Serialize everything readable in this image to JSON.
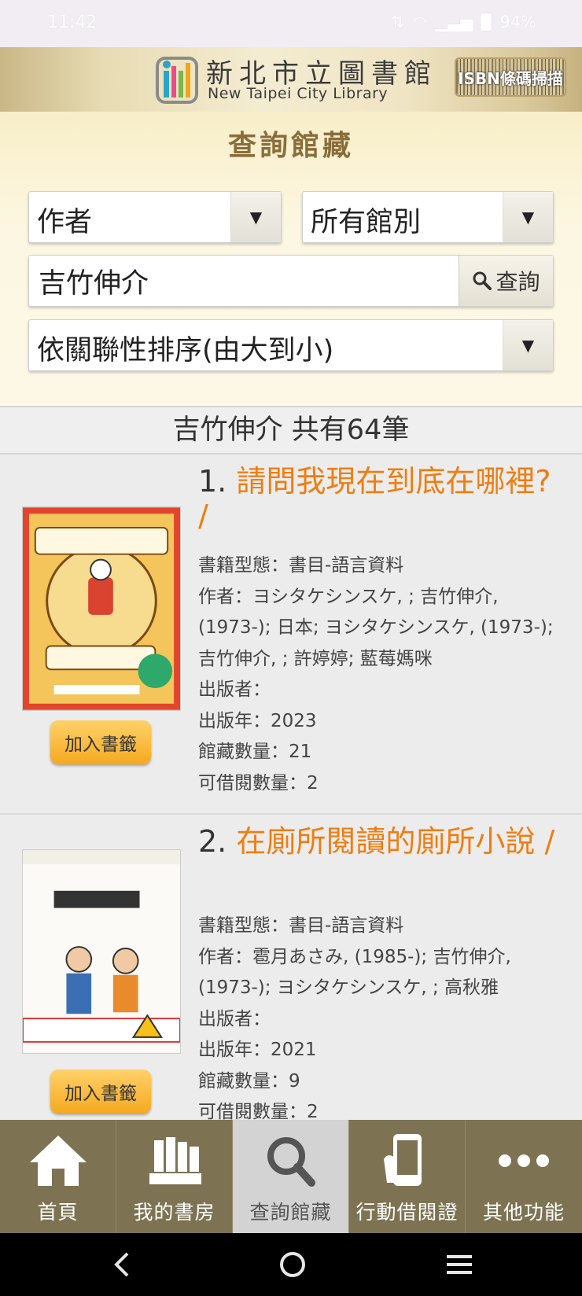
{
  "status_bar": {
    "time": "11:42",
    "battery": "94%"
  },
  "header": {
    "library_name_cn": "新北市立圖書館",
    "library_name_en": "New Taipei City Library",
    "isbn_button": "ISBN條碼掃描"
  },
  "search": {
    "panel_title": "查詢館藏",
    "field_select": "作者",
    "branch_select": "所有館別",
    "query": "吉竹伸介",
    "search_button": "查詢",
    "sort_select": "依關聯性排序(由大到小)"
  },
  "results": {
    "summary": "吉竹伸介 共有64筆",
    "items": [
      {
        "num": "1.",
        "title": "請問我現在到底在哪裡? /",
        "bookmark": "加入書籤",
        "type": "書籍型態：書目-語言資料",
        "author": "作者：ヨシタケシンスケ, ; 吉竹伸介, (1973-); 日本; ヨシタケシンスケ, (1973-); 吉竹伸介, ; 許婷婷; 藍莓媽咪",
        "publisher": "出版者：",
        "year": "出版年：2023",
        "holdings": "館藏數量：21",
        "available": "可借閱數量：2"
      },
      {
        "num": "2.",
        "title": "在廁所閱讀的廁所小說 /",
        "bookmark": "加入書籤",
        "type": "書籍型態：書目-語言資料",
        "author": "作者：雹月あさみ, (1985-); 吉竹伸介, (1973-); ヨシタケシンスケ, ; 高秋雅",
        "publisher": "出版者：",
        "year": "出版年：2021",
        "holdings": "館藏數量：9",
        "available": "可借閱數量：2"
      }
    ]
  },
  "nav": {
    "items": [
      {
        "label": "首頁",
        "icon": "home-icon"
      },
      {
        "label": "我的書房",
        "icon": "books-icon"
      },
      {
        "label": "查詢館藏",
        "icon": "search-icon",
        "active": true
      },
      {
        "label": "行動借閱證",
        "icon": "phone-card-icon"
      },
      {
        "label": "其他功能",
        "icon": "more-icon"
      }
    ]
  }
}
